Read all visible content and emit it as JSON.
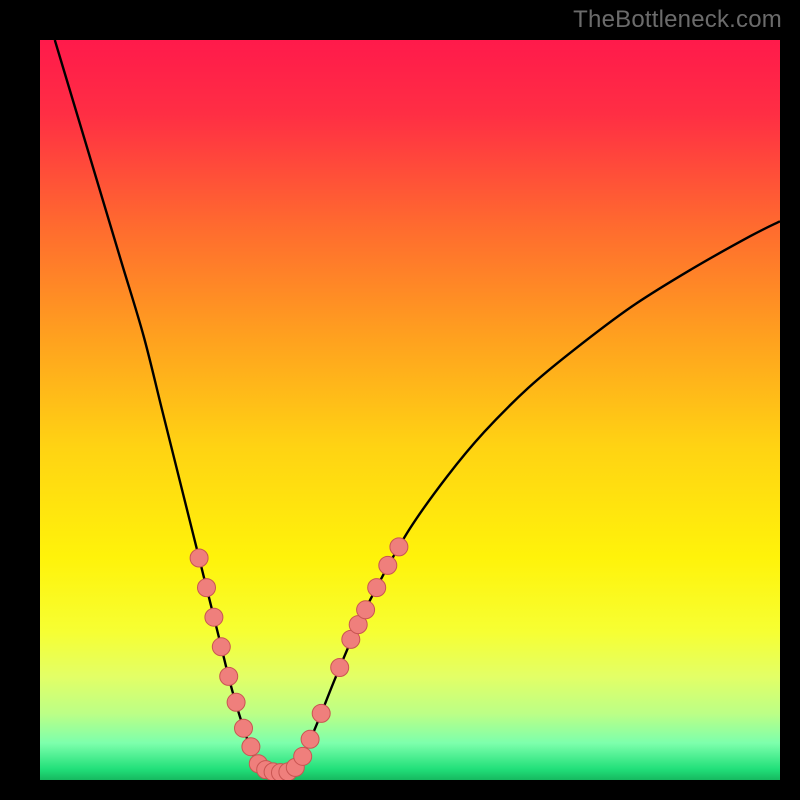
{
  "watermark": "TheBottleneck.com",
  "chart_data": {
    "type": "line",
    "title": "",
    "xlabel": "",
    "ylabel": "",
    "xlim": [
      0,
      100
    ],
    "ylim": [
      0,
      100
    ],
    "grid": false,
    "legend": false,
    "gradient_stops": [
      {
        "offset": 0.0,
        "color": "#ff1a4b"
      },
      {
        "offset": 0.1,
        "color": "#ff2e44"
      },
      {
        "offset": 0.25,
        "color": "#ff6a2f"
      },
      {
        "offset": 0.4,
        "color": "#ffa01f"
      },
      {
        "offset": 0.55,
        "color": "#ffd313"
      },
      {
        "offset": 0.7,
        "color": "#fff30a"
      },
      {
        "offset": 0.8,
        "color": "#f6ff33"
      },
      {
        "offset": 0.86,
        "color": "#e3ff66"
      },
      {
        "offset": 0.91,
        "color": "#bcff86"
      },
      {
        "offset": 0.95,
        "color": "#7dffac"
      },
      {
        "offset": 0.985,
        "color": "#22e07a"
      },
      {
        "offset": 1.0,
        "color": "#16b85f"
      }
    ],
    "series": [
      {
        "name": "curve",
        "stroke": "#000000",
        "points": [
          {
            "x": 2.0,
            "y": 100.0
          },
          {
            "x": 5.0,
            "y": 90.0
          },
          {
            "x": 8.0,
            "y": 80.0
          },
          {
            "x": 11.0,
            "y": 70.0
          },
          {
            "x": 14.0,
            "y": 60.0
          },
          {
            "x": 16.5,
            "y": 50.0
          },
          {
            "x": 19.0,
            "y": 40.0
          },
          {
            "x": 21.5,
            "y": 30.0
          },
          {
            "x": 24.0,
            "y": 20.0
          },
          {
            "x": 26.0,
            "y": 12.0
          },
          {
            "x": 28.0,
            "y": 5.5
          },
          {
            "x": 29.0,
            "y": 3.0
          },
          {
            "x": 30.0,
            "y": 1.8
          },
          {
            "x": 31.0,
            "y": 1.2
          },
          {
            "x": 32.0,
            "y": 1.0
          },
          {
            "x": 33.0,
            "y": 1.0
          },
          {
            "x": 34.0,
            "y": 1.2
          },
          {
            "x": 35.0,
            "y": 2.2
          },
          {
            "x": 36.0,
            "y": 4.2
          },
          {
            "x": 38.0,
            "y": 9.0
          },
          {
            "x": 40.0,
            "y": 14.0
          },
          {
            "x": 43.0,
            "y": 21.0
          },
          {
            "x": 46.0,
            "y": 27.0
          },
          {
            "x": 50.0,
            "y": 34.0
          },
          {
            "x": 55.0,
            "y": 41.0
          },
          {
            "x": 60.0,
            "y": 47.0
          },
          {
            "x": 66.0,
            "y": 53.0
          },
          {
            "x": 72.0,
            "y": 58.0
          },
          {
            "x": 80.0,
            "y": 64.0
          },
          {
            "x": 88.0,
            "y": 69.0
          },
          {
            "x": 96.0,
            "y": 73.5
          },
          {
            "x": 100.0,
            "y": 75.5
          }
        ]
      }
    ],
    "markers": {
      "fill": "#ef7f7c",
      "stroke": "#c95552",
      "radius": 9,
      "points": [
        {
          "x": 21.5,
          "y": 30.0
        },
        {
          "x": 22.5,
          "y": 26.0
        },
        {
          "x": 23.5,
          "y": 22.0
        },
        {
          "x": 24.5,
          "y": 18.0
        },
        {
          "x": 25.5,
          "y": 14.0
        },
        {
          "x": 26.5,
          "y": 10.5
        },
        {
          "x": 27.5,
          "y": 7.0
        },
        {
          "x": 28.5,
          "y": 4.5
        },
        {
          "x": 29.5,
          "y": 2.2
        },
        {
          "x": 30.5,
          "y": 1.4
        },
        {
          "x": 31.5,
          "y": 1.1
        },
        {
          "x": 32.5,
          "y": 1.0
        },
        {
          "x": 33.5,
          "y": 1.1
        },
        {
          "x": 34.5,
          "y": 1.7
        },
        {
          "x": 35.5,
          "y": 3.2
        },
        {
          "x": 36.5,
          "y": 5.5
        },
        {
          "x": 38.0,
          "y": 9.0
        },
        {
          "x": 40.5,
          "y": 15.2
        },
        {
          "x": 42.0,
          "y": 19.0
        },
        {
          "x": 43.0,
          "y": 21.0
        },
        {
          "x": 44.0,
          "y": 23.0
        },
        {
          "x": 45.5,
          "y": 26.0
        },
        {
          "x": 47.0,
          "y": 29.0
        },
        {
          "x": 48.5,
          "y": 31.5
        }
      ]
    }
  }
}
